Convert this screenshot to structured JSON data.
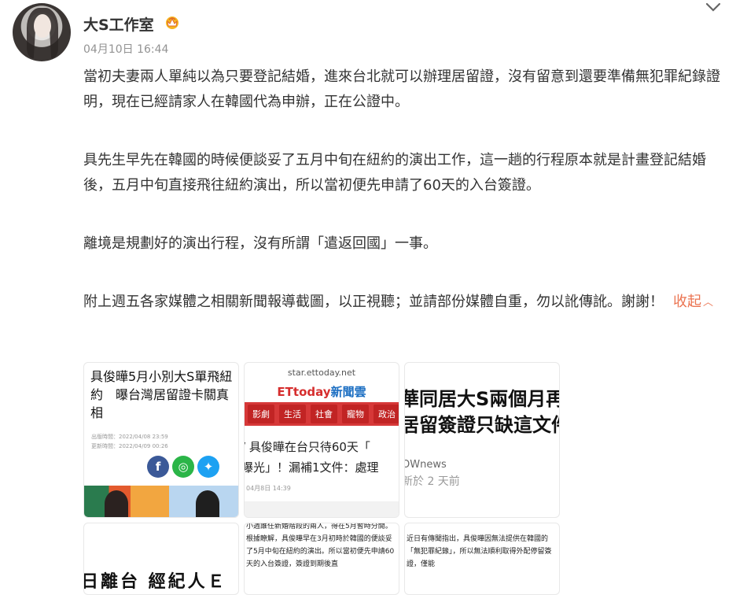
{
  "user": {
    "name": "大S工作室",
    "timestamp": "04月10日 16:44"
  },
  "post": {
    "paragraphs": [
      "當初夫妻兩人單純以為只要登記結婚，進來台北就可以辦理居留證，沒有留意到還要準備無犯罪紀錄證明，現在已經請家人在韓國代為申辦，正在公證中。",
      "具先生早先在韓國的時候便談妥了五月中旬在紐約的演出工作，這一趟的行程原本就是計畫登記結婚後，五月中旬直接飛往紐約演出，所以當初便先申請了60天的入台簽證。",
      "離境是規劃好的演出行程，沒有所謂「遣返回國」一事。",
      "附上週五各家媒體之相關新聞報導截圖，以正視聽；並請部份媒體自重，勿以訛傳訛。謝謝！"
    ],
    "collapse_label": "收起"
  },
  "images": {
    "img1": {
      "headline": "具俊曄5月小別大S單飛紐約　曝台灣居留證卡關真相",
      "published": "出版時間：2022/04/08 23:59",
      "updated": "更新時間：2022/04/09 00:26",
      "share_icons": [
        "facebook-icon",
        "line-icon",
        "twitter-icon"
      ]
    },
    "img2": {
      "site": "star.ettoday.net",
      "logo_a": "ETtoday",
      "logo_b": "新聞雲",
      "nav": [
        "影劇",
        "生活",
        "社會",
        "寵物",
        "政治"
      ],
      "headline_1": "/ 具俊曄在台只待60天「",
      "headline_2": "曝光」！漏補1文件：處理",
      "date": "04月8日 14:39"
    },
    "img3": {
      "line_1": "華同居大S兩個月再",
      "line_2": "居留簽證只缺這文件",
      "source": "OWnews",
      "ago": "新於 2 天前"
    },
    "img4": {
      "text": "日離台 經紀人Ｅ"
    },
    "img5": {
      "text": "小週誰任新婚階段的兩人，得在5月暫時分開。根據瞭解，具俊曄早在3月初時於韓國的便談妥了5月中旬在紐約的演出。所以當初便先申請60天的入台簽證，簽證到期後直"
    },
    "img6": {
      "text": "近日有傳聞指出，具俊曄因無法提供在韓國的「無犯罪紀錄」，所以無法順利取得外配停留簽證，僅能"
    }
  },
  "colors": {
    "link": "#eb7350",
    "text": "#333333",
    "meta": "#939393",
    "ettoday_red": "#d63838"
  }
}
